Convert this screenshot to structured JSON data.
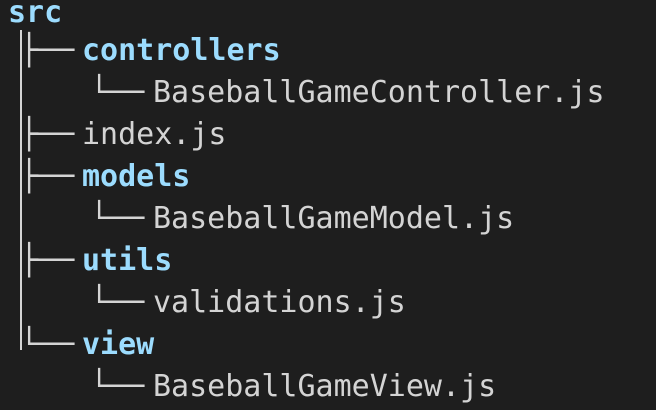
{
  "tree": {
    "root": "src",
    "entries": [
      {
        "name": "controllers",
        "type": "folder",
        "children": [
          "BaseballGameController.js"
        ]
      },
      {
        "name": "index.js",
        "type": "file"
      },
      {
        "name": "models",
        "type": "folder",
        "children": [
          "BaseballGameModel.js"
        ]
      },
      {
        "name": "utils",
        "type": "folder",
        "children": [
          "validations.js"
        ]
      },
      {
        "name": "view",
        "type": "folder",
        "children": [
          "BaseballGameView.js"
        ]
      }
    ],
    "glyphs": {
      "branch": "├──",
      "last_branch": "└──",
      "child_branch": "└──"
    }
  },
  "colors": {
    "background": "#1e1e1e",
    "folder": "#9cdcfe",
    "file": "#d4d4d4"
  }
}
